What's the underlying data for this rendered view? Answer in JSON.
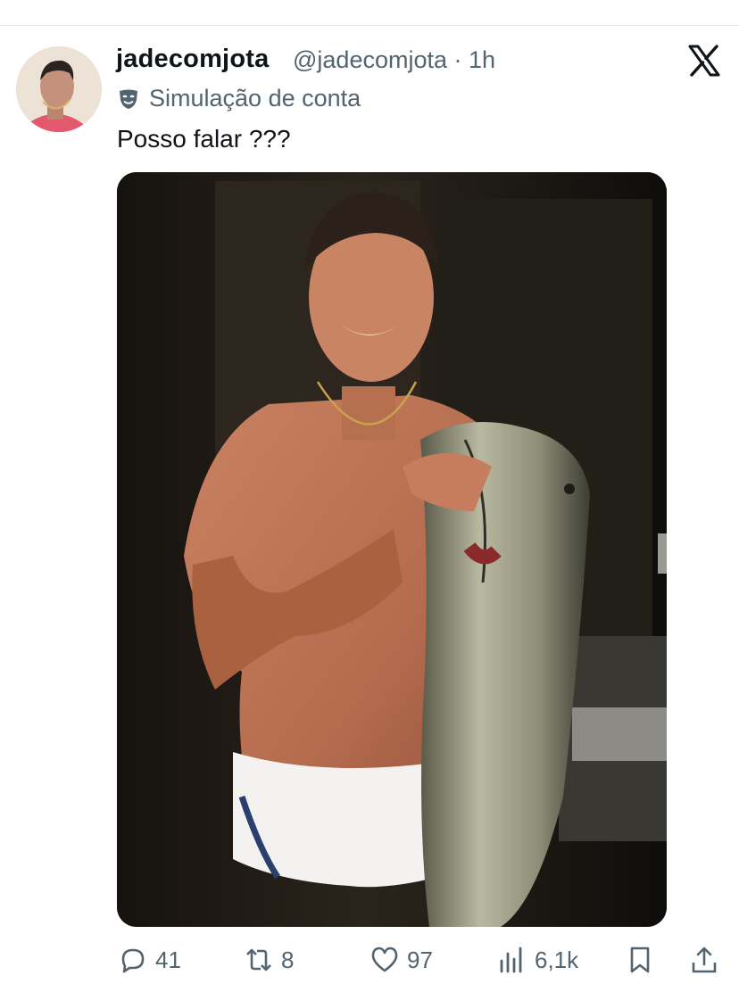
{
  "tweet": {
    "display_name": "jadecomjota",
    "handle_time": "@jadecomjota · 1h",
    "account_label": "Simulação de conta",
    "text": "Posso falar ???"
  },
  "icons": {
    "brand": "x-logo-icon",
    "label": "theater-mask-icon",
    "reply": "reply-icon",
    "retweet": "retweet-icon",
    "like": "heart-icon",
    "views": "views-chart-icon",
    "bookmark": "bookmark-icon",
    "share": "share-icon"
  },
  "stats": {
    "replies": "41",
    "retweets": "8",
    "likes": "97",
    "views": "6,1k"
  },
  "colors": {
    "text": "#0f1419",
    "secondary": "#536471",
    "divider": "#e6e6e6"
  }
}
